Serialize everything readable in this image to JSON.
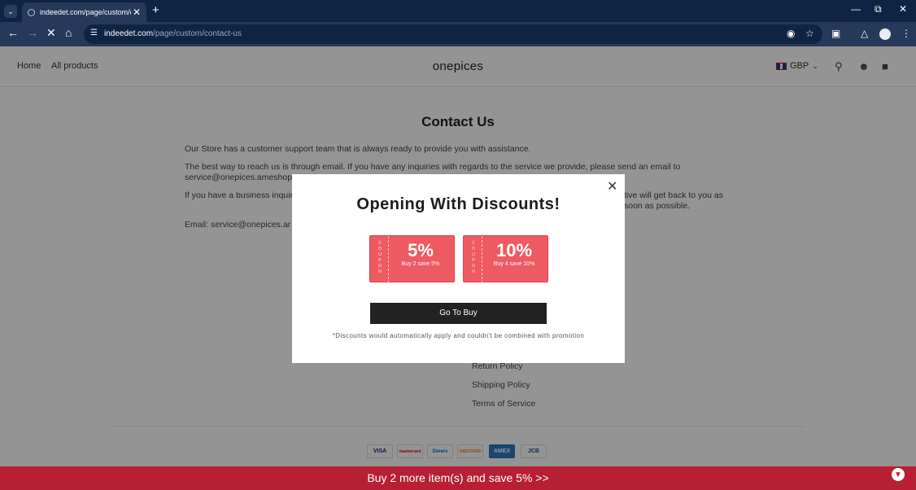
{
  "browser": {
    "tab_title": "indeedet.com/page/custom/contact-us",
    "url_host": "indeedet.com",
    "url_path": "/page/custom/contact-us"
  },
  "header": {
    "nav": [
      "Home",
      "All products"
    ],
    "brand": "onepices",
    "currency": "GBP"
  },
  "main": {
    "title": "Contact Us",
    "paragraphs": [
      "Our Store has a customer support team that is always ready to provide you with assistance.",
      "The best way to reach us is through email. If you have any inquiries with regards to the service we provide, please send an email to service@onepices.ameshop.",
      "If you have a business inquiry",
      "tive will get back to you as soon as possible.",
      "Email:   service@onepices.ar"
    ]
  },
  "footer": {
    "links": [
      "Return Policy",
      "Shipping Policy",
      "Terms of Service"
    ],
    "payments": [
      "VISA",
      "mastercard",
      "Diners",
      "DISCOVER",
      "AMEX",
      "JCB"
    ]
  },
  "promo_bar": "Buy 2 more item(s) and save 5%  >>",
  "modal": {
    "title": "Opening With Discounts!",
    "coupons": [
      {
        "tag": "COUPON",
        "amount": "5%",
        "desc": "Buy 2 save 5%"
      },
      {
        "tag": "COUPON",
        "amount": "10%",
        "desc": "Buy 4 save 10%"
      }
    ],
    "button": "Go To Buy",
    "note": "*Discounts would automatically apply and couldn't be combined with promotion"
  },
  "colors": {
    "browser_frame": "#0f2343",
    "toolbar": "#26395b",
    "coupon": "#ee5a62",
    "promo": "#b61f34",
    "button": "#222222"
  }
}
